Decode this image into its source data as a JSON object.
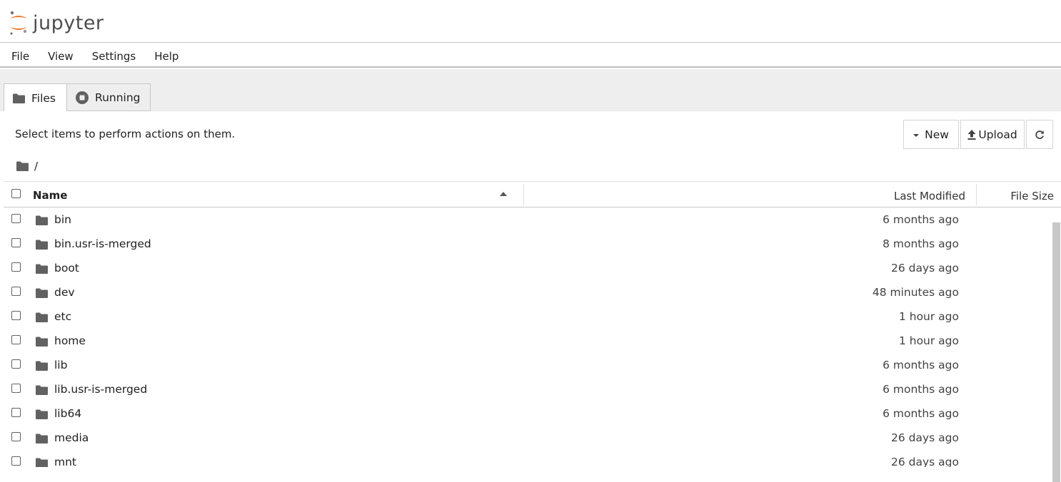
{
  "app": {
    "logo_text": "jupyter"
  },
  "menu": {
    "items": [
      "File",
      "View",
      "Settings",
      "Help"
    ]
  },
  "tabs": {
    "files": "Files",
    "running": "Running"
  },
  "toolbar": {
    "message": "Select items to perform actions on them.",
    "new_label": "New",
    "upload_label": "Upload"
  },
  "breadcrumb": {
    "path": "/"
  },
  "columns": {
    "name": "Name",
    "last_modified": "Last Modified",
    "file_size": "File Size"
  },
  "files": [
    {
      "name": "bin",
      "modified": "6 months ago"
    },
    {
      "name": "bin.usr-is-merged",
      "modified": "8 months ago"
    },
    {
      "name": "boot",
      "modified": "26 days ago"
    },
    {
      "name": "dev",
      "modified": "48 minutes ago"
    },
    {
      "name": "etc",
      "modified": "1 hour ago"
    },
    {
      "name": "home",
      "modified": "1 hour ago"
    },
    {
      "name": "lib",
      "modified": "6 months ago"
    },
    {
      "name": "lib.usr-is-merged",
      "modified": "6 months ago"
    },
    {
      "name": "lib64",
      "modified": "6 months ago"
    },
    {
      "name": "media",
      "modified": "26 days ago"
    },
    {
      "name": "mnt",
      "modified": "26 days ago"
    }
  ],
  "colors": {
    "logo_orange": "#f37726",
    "folder_icon": "#616161"
  }
}
